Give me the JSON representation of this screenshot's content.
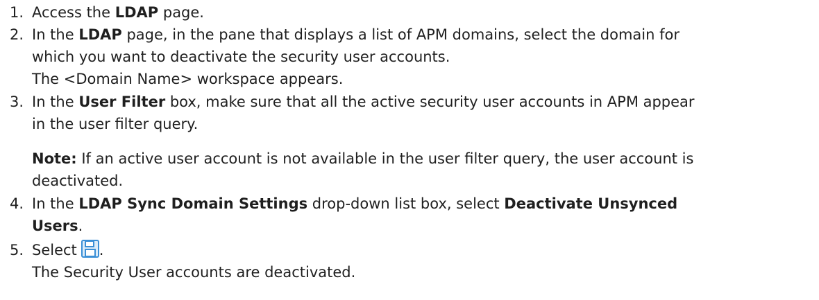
{
  "steps": [
    {
      "number": "1.",
      "t1": "Access the ",
      "b1": "LDAP",
      "t2": " page."
    },
    {
      "number": "2.",
      "t1": "In the ",
      "b1": "LDAP",
      "t2": " page, in the pane that displays a list of APM domains, select the domain for",
      "t3": "which you want to deactivate the security user accounts.",
      "t4": "The <Domain Name> workspace appears."
    },
    {
      "number": "3.",
      "t1": "In the ",
      "b1": "User Filter",
      "t2": " box, make sure that all the active security user accounts in APM appear",
      "t3": "in the user filter query.",
      "note_label": "Note:",
      "note_t1": " If an active user account is not available in the user filter query, the user account is",
      "note_t2": "deactivated."
    },
    {
      "number": "4.",
      "t1": "In the ",
      "b1": "LDAP Sync Domain Settings",
      "t2": " drop-down list box, select ",
      "b2": "Deactivate Unsynced",
      "b3": "Users",
      "t3": "."
    },
    {
      "number": "5.",
      "t1": "Select",
      "icon": "save-icon",
      "t2": ".",
      "t3": "The Security User accounts are deactivated."
    }
  ],
  "colors": {
    "text": "#1f1f1f",
    "icon_blue": "#3b8fd6",
    "icon_light": "#dcecf9"
  }
}
